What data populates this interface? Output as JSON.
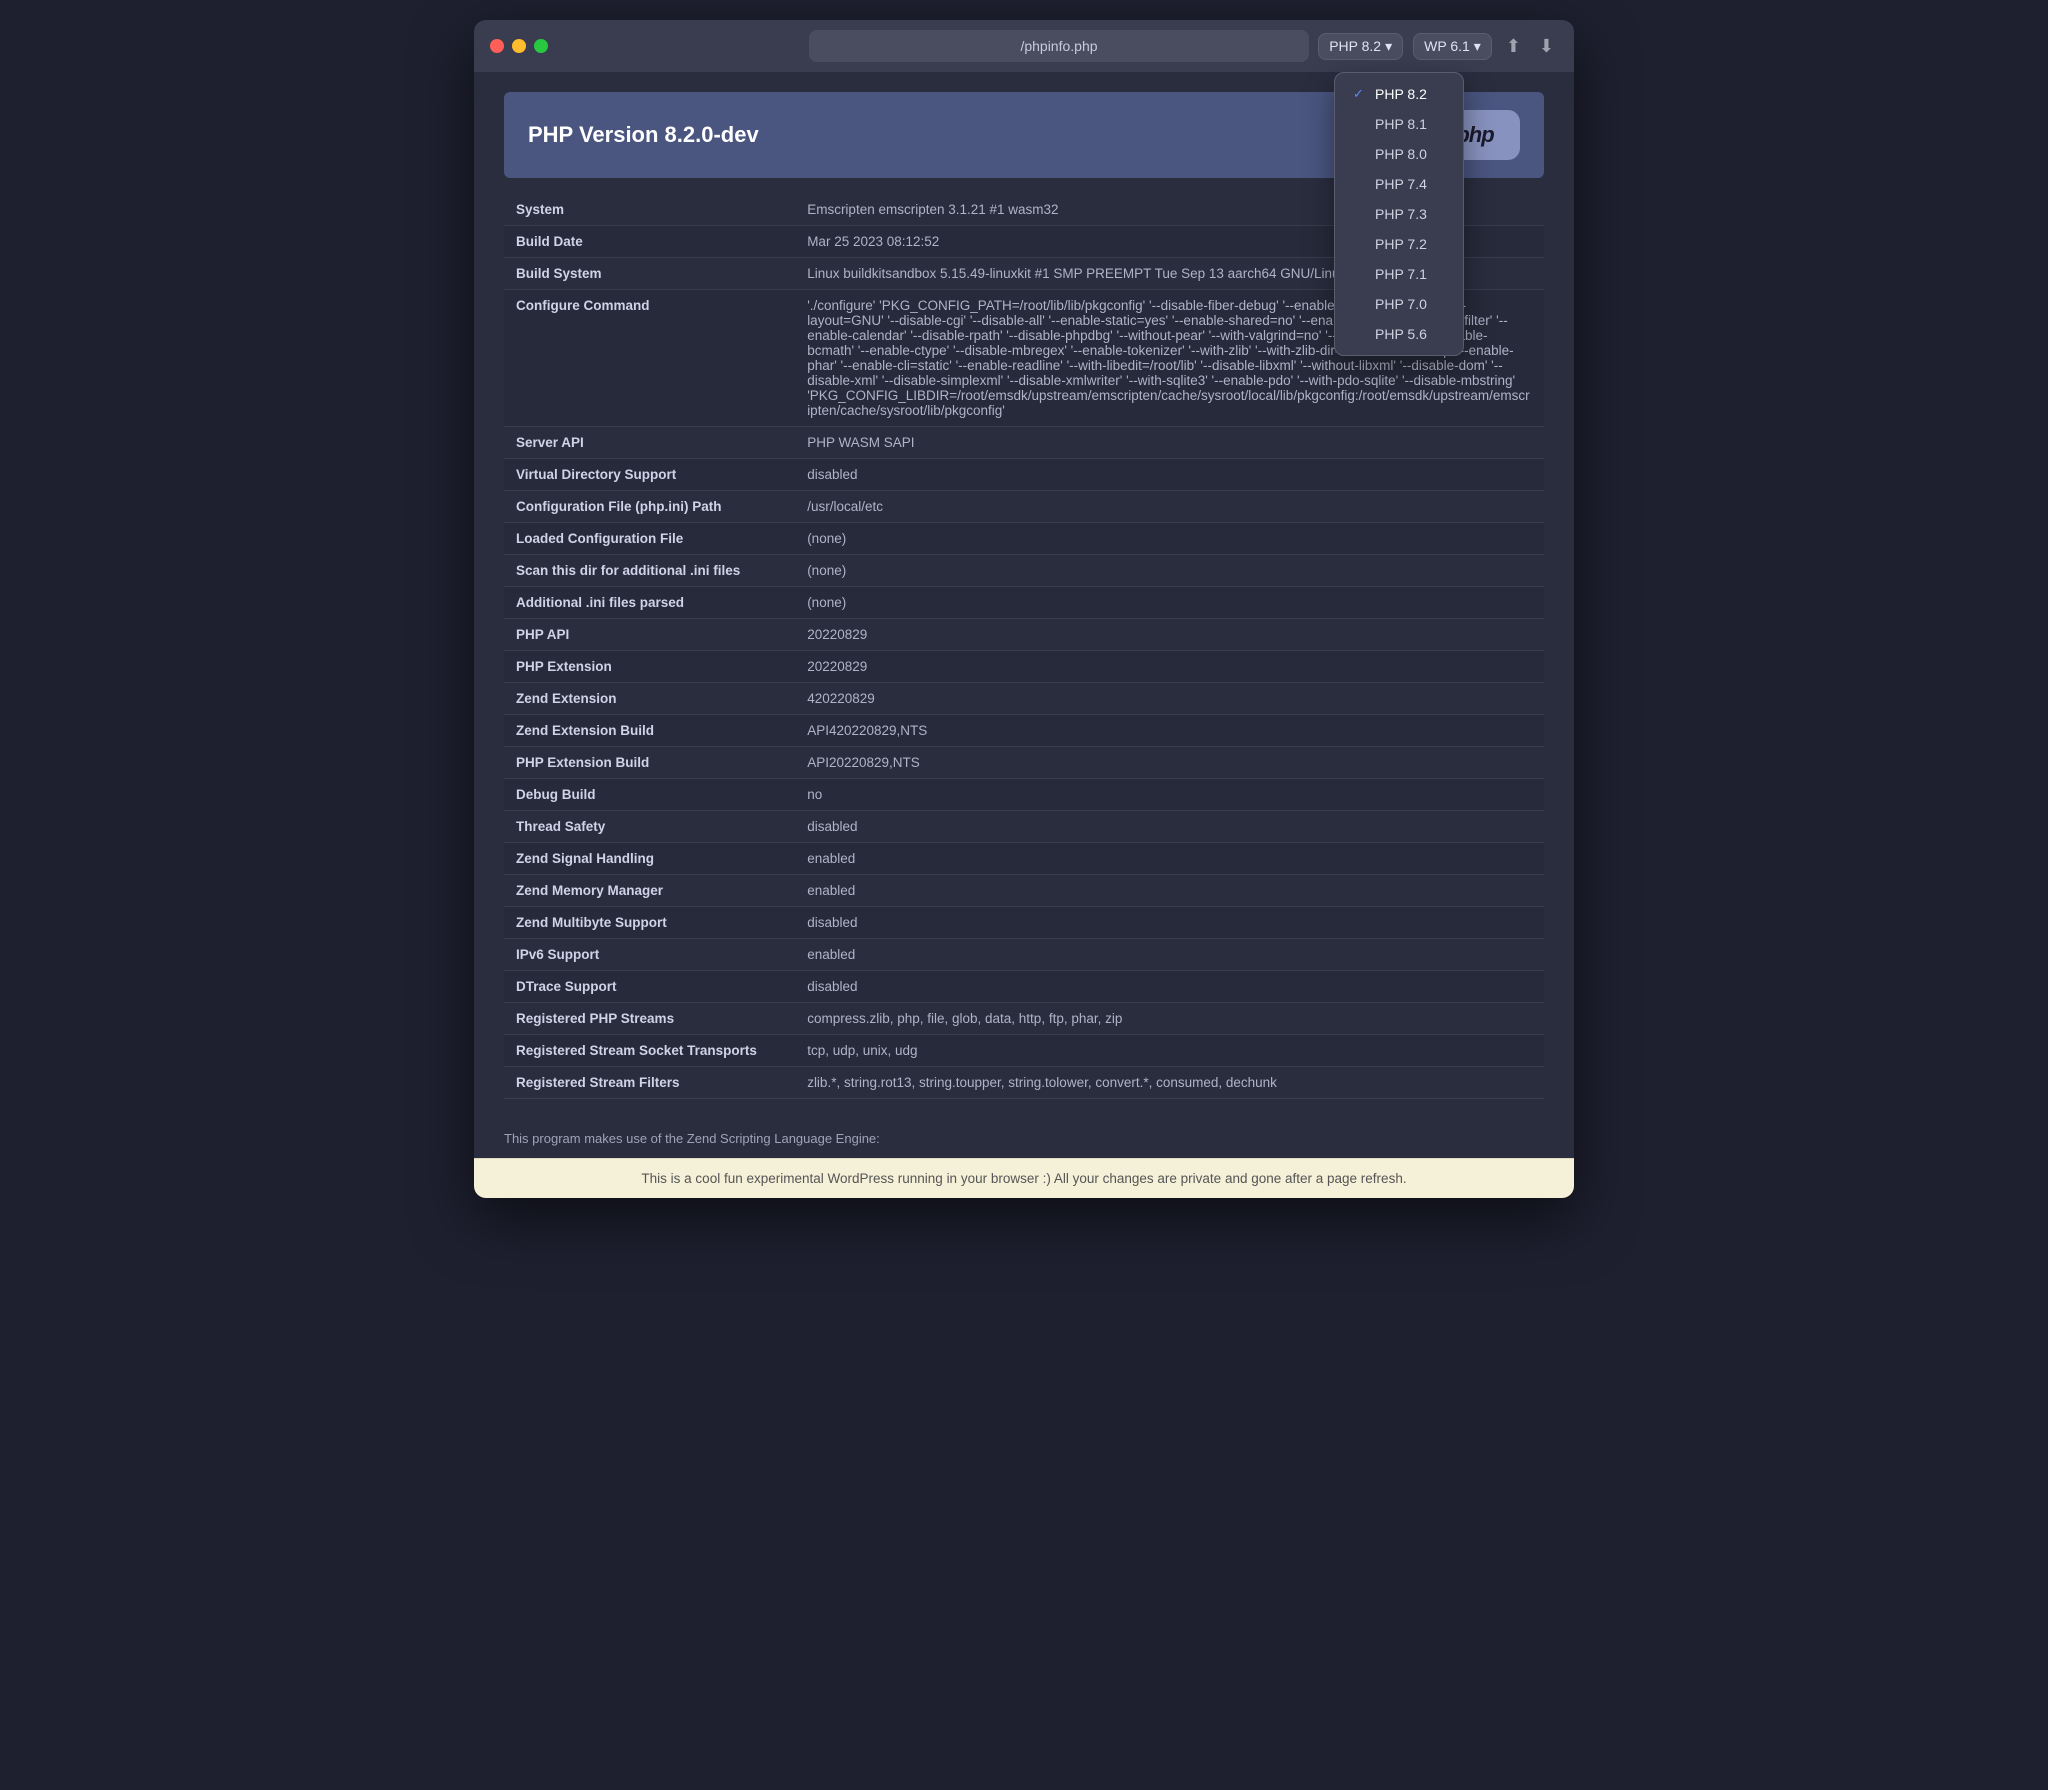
{
  "window": {
    "url": "/phpinfo.php"
  },
  "titlebar": {
    "php_version_label": "PHP 8.2",
    "wp_version_label": "WP 6.1",
    "upload_icon": "↑",
    "download_icon": "↓"
  },
  "dropdown": {
    "versions": [
      {
        "label": "PHP 8.2",
        "selected": true
      },
      {
        "label": "PHP 8.1",
        "selected": false
      },
      {
        "label": "PHP 8.0",
        "selected": false
      },
      {
        "label": "PHP 7.4",
        "selected": false
      },
      {
        "label": "PHP 7.3",
        "selected": false
      },
      {
        "label": "PHP 7.2",
        "selected": false
      },
      {
        "label": "PHP 7.1",
        "selected": false
      },
      {
        "label": "PHP 7.0",
        "selected": false
      },
      {
        "label": "PHP 5.6",
        "selected": false
      }
    ]
  },
  "php_header": {
    "title": "PHP Version 8.2.0-dev",
    "logo": "php"
  },
  "table_rows": [
    {
      "key": "System",
      "value": "Emscripten emscripten 3.1.21 #1 wasm32"
    },
    {
      "key": "Build Date",
      "value": "Mar 25 2023 08:12:52"
    },
    {
      "key": "Build System",
      "value": "Linux buildkitsandbox 5.15.49-linuxkit #1 SMP PREEMPT Tue Sep 13 aarch64 GNU/Linux"
    },
    {
      "key": "Configure Command",
      "value": "'./configure' 'PKG_CONFIG_PATH=/root/lib/lib/pkgconfig' '--disable-fiber-debug' '--enable-embed=static' '--with-layout=GNU' '--disable-cgi' '--disable-all' '--enable-static=yes' '--enable-shared=no' '--enable-session' '--enable-filter' '--enable-calendar' '--disable-rpath' '--disable-phpdbg' '--without-pear' '--with-valgrind=no' '--without-pcre-jit' '--enable-bcmath' '--enable-ctype' '--disable-mbregex' '--enable-tokenizer' '--with-zlib' '--with-zlib-dir=/root/lib' '--with-zip' '--enable-phar' '--enable-cli=static' '--enable-readline' '--with-libedit=/root/lib' '--disable-libxml' '--without-libxml' '--disable-dom' '--disable-xml' '--disable-simplexml' '--disable-xmlwriter' '--with-sqlite3' '--enable-pdo' '--with-pdo-sqlite' '--disable-mbstring' 'PKG_CONFIG_LIBDIR=/root/emsdk/upstream/emscripten/cache/sysroot/local/lib/pkgconfig:/root/emsdk/upstream/emscripten/cache/sysroot/lib/pkgconfig'"
    },
    {
      "key": "Server API",
      "value": "PHP WASM SAPI"
    },
    {
      "key": "Virtual Directory Support",
      "value": "disabled"
    },
    {
      "key": "Configuration File (php.ini) Path",
      "value": "/usr/local/etc"
    },
    {
      "key": "Loaded Configuration File",
      "value": "(none)"
    },
    {
      "key": "Scan this dir for additional .ini files",
      "value": "(none)"
    },
    {
      "key": "Additional .ini files parsed",
      "value": "(none)"
    },
    {
      "key": "PHP API",
      "value": "20220829"
    },
    {
      "key": "PHP Extension",
      "value": "20220829"
    },
    {
      "key": "Zend Extension",
      "value": "420220829"
    },
    {
      "key": "Zend Extension Build",
      "value": "API420220829,NTS"
    },
    {
      "key": "PHP Extension Build",
      "value": "API20220829,NTS"
    },
    {
      "key": "Debug Build",
      "value": "no"
    },
    {
      "key": "Thread Safety",
      "value": "disabled"
    },
    {
      "key": "Zend Signal Handling",
      "value": "enabled"
    },
    {
      "key": "Zend Memory Manager",
      "value": "enabled"
    },
    {
      "key": "Zend Multibyte Support",
      "value": "disabled"
    },
    {
      "key": "IPv6 Support",
      "value": "enabled"
    },
    {
      "key": "DTrace Support",
      "value": "disabled"
    },
    {
      "key": "Registered PHP Streams",
      "value": "compress.zlib, php, file, glob, data, http, ftp, phar, zip"
    },
    {
      "key": "Registered Stream Socket Transports",
      "value": "tcp, udp, unix, udg"
    },
    {
      "key": "Registered Stream Filters",
      "value": "zlib.*, string.rot13, string.toupper, string.tolower, convert.*, consumed, dechunk"
    }
  ],
  "footer_text": "This program makes use of the Zend Scripting Language Engine:",
  "bottom_bar_text": "This is a cool fun experimental WordPress running in your browser :) All your changes are private and gone after a page refresh."
}
